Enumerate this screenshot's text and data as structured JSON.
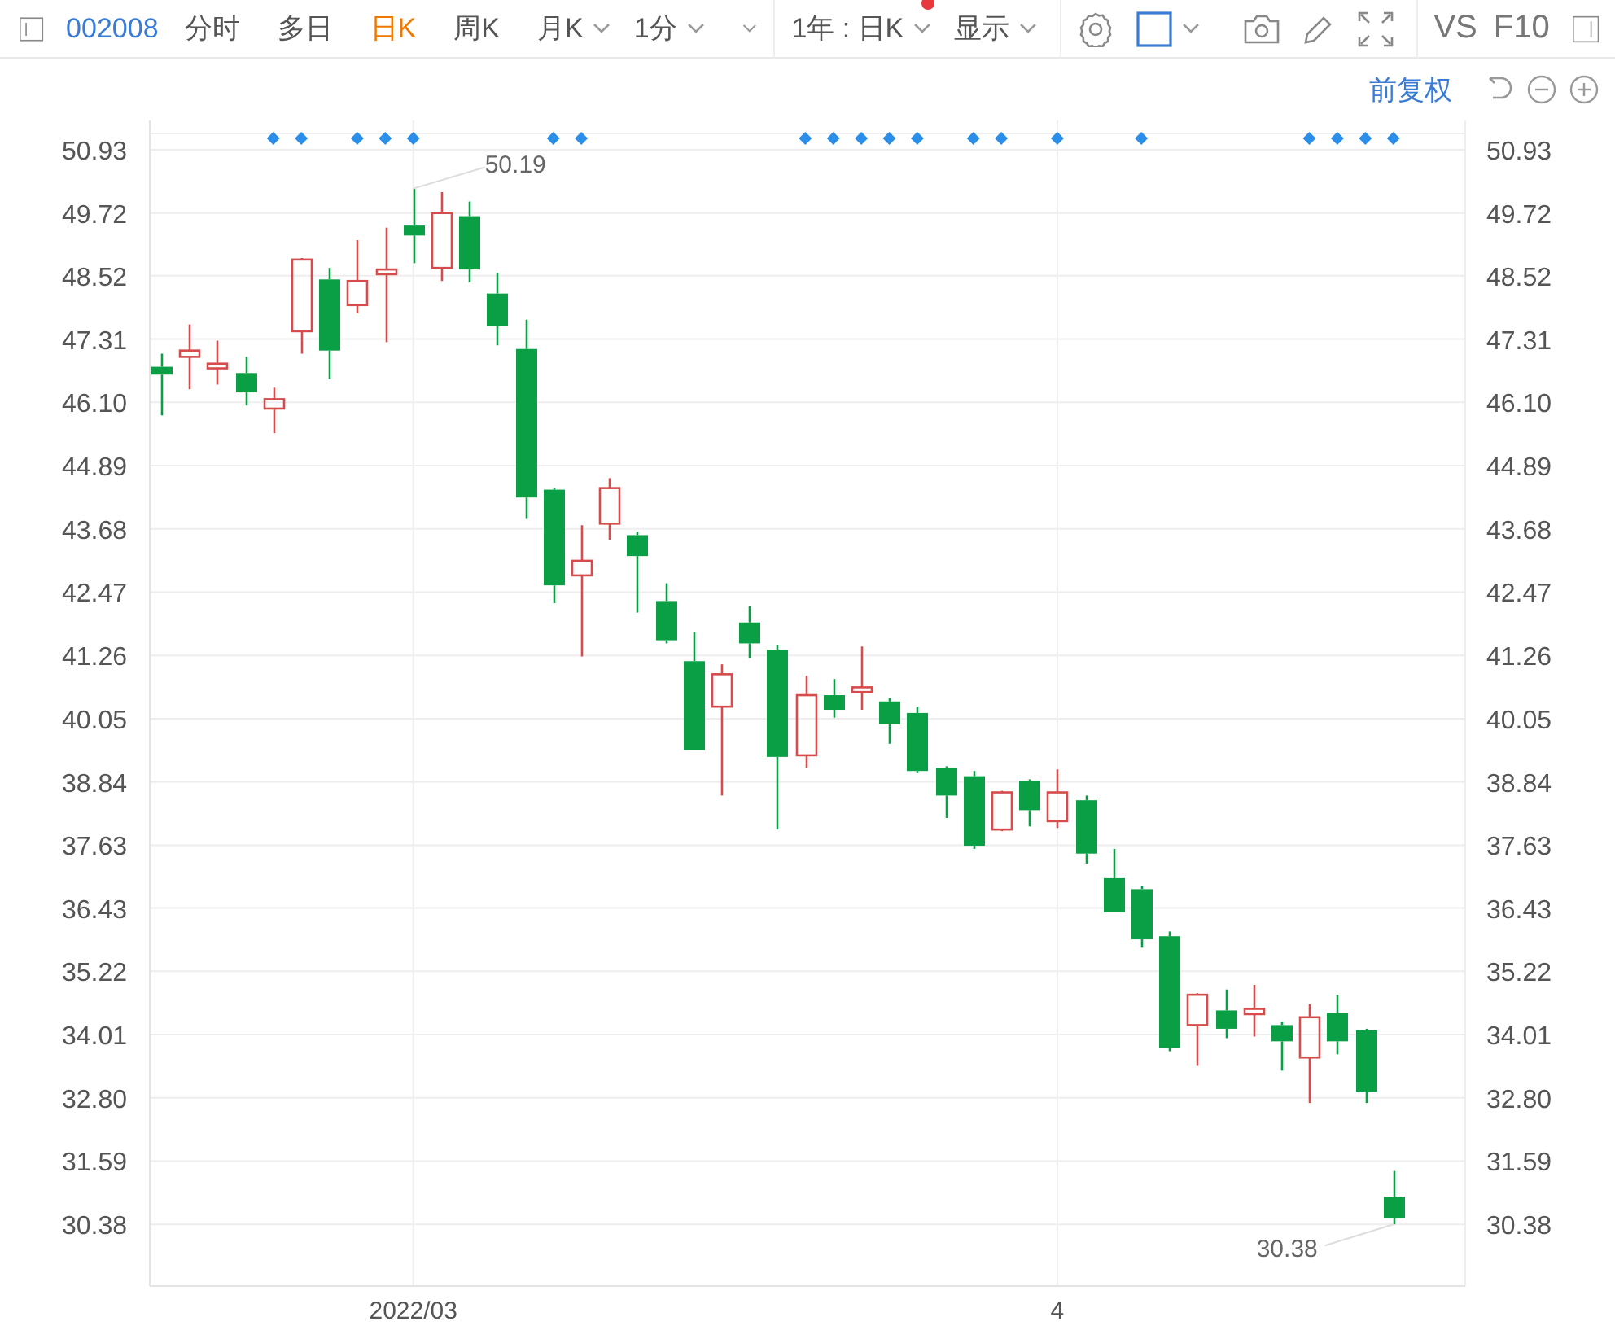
{
  "toolbar": {
    "stock_code": "002008",
    "periods": [
      {
        "label": "分时",
        "kind": "tab",
        "selected": false
      },
      {
        "label": "多日",
        "kind": "tab",
        "selected": false
      },
      {
        "label": "日K",
        "kind": "tab",
        "selected": true
      },
      {
        "label": "周K",
        "kind": "tab",
        "selected": false
      },
      {
        "label": "月K",
        "kind": "dropdown",
        "selected": false
      }
    ],
    "interval": "1分",
    "range": "1年 : 日K",
    "range_notice": true,
    "display": "显示",
    "compare": "VS",
    "f10": "F10"
  },
  "chart_toolbar": {
    "adjustment": "前复权"
  },
  "chart": {
    "event_markers": [
      {
        "shown": false
      },
      {
        "shown": false
      },
      {
        "shown": false
      },
      {
        "shown": false
      },
      {
        "shown": true
      },
      {
        "shown": true
      },
      {
        "shown": false
      },
      {
        "shown": true
      },
      {
        "shown": true
      },
      {
        "shown": true
      },
      {
        "shown": false
      },
      {
        "shown": false
      },
      {
        "shown": false
      },
      {
        "shown": false
      },
      {
        "shown": true
      },
      {
        "shown": true
      },
      {
        "shown": false
      },
      {
        "shown": false
      },
      {
        "shown": false
      },
      {
        "shown": false
      },
      {
        "shown": false
      },
      {
        "shown": false
      },
      {
        "shown": false
      },
      {
        "shown": true
      },
      {
        "shown": true
      },
      {
        "shown": true
      },
      {
        "shown": true
      },
      {
        "shown": true
      },
      {
        "shown": false
      },
      {
        "shown": true
      },
      {
        "shown": true
      },
      {
        "shown": false
      },
      {
        "shown": true
      },
      {
        "shown": false
      },
      {
        "shown": false
      },
      {
        "shown": true
      },
      {
        "shown": false
      },
      {
        "shown": false
      },
      {
        "shown": false
      },
      {
        "shown": false
      },
      {
        "shown": false
      },
      {
        "shown": true
      },
      {
        "shown": true
      },
      {
        "shown": true
      },
      {
        "shown": true
      }
    ],
    "chart_data": {
      "type": "candlestick",
      "grid": true,
      "ylim": [
        29.2,
        51.49
      ],
      "yticks": [
        {
          "value": 50.93,
          "label": "50.93"
        },
        {
          "value": 49.72,
          "label": "49.72"
        },
        {
          "value": 48.52,
          "label": "48.52"
        },
        {
          "value": 47.31,
          "label": "47.31"
        },
        {
          "value": 46.1,
          "label": "46.10"
        },
        {
          "value": 44.89,
          "label": "44.89"
        },
        {
          "value": 43.68,
          "label": "43.68"
        },
        {
          "value": 42.47,
          "label": "42.47"
        },
        {
          "value": 41.26,
          "label": "41.26"
        },
        {
          "value": 40.05,
          "label": "40.05"
        },
        {
          "value": 38.84,
          "label": "38.84"
        },
        {
          "value": 37.63,
          "label": "37.63"
        },
        {
          "value": 36.43,
          "label": "36.43"
        },
        {
          "value": 35.22,
          "label": "35.22"
        },
        {
          "value": 34.01,
          "label": "34.01"
        },
        {
          "value": 32.8,
          "label": "32.80"
        },
        {
          "value": 31.59,
          "label": "31.59"
        },
        {
          "value": 30.38,
          "label": "30.38"
        }
      ],
      "categories": [
        null,
        null,
        null,
        null,
        null,
        null,
        null,
        null,
        null,
        "2022/03",
        null,
        null,
        null,
        null,
        null,
        null,
        null,
        null,
        null,
        null,
        null,
        null,
        null,
        null,
        null,
        null,
        null,
        null,
        null,
        null,
        null,
        null,
        "4",
        null,
        null,
        null,
        null,
        null,
        null,
        null,
        null,
        null,
        null,
        null,
        null
      ],
      "ohlc": [
        [
          46.78,
          47.03,
          45.85,
          46.63
        ],
        [
          46.97,
          47.59,
          46.35,
          47.09
        ],
        [
          46.75,
          47.28,
          46.44,
          46.84
        ],
        [
          46.66,
          46.97,
          46.04,
          46.29
        ],
        [
          45.98,
          46.38,
          45.51,
          46.16
        ],
        [
          47.46,
          48.86,
          47.03,
          48.83
        ],
        [
          48.45,
          48.67,
          46.54,
          47.09
        ],
        [
          47.96,
          49.2,
          47.8,
          48.42
        ],
        [
          48.55,
          49.44,
          47.25,
          48.64
        ],
        [
          49.48,
          50.19,
          48.76,
          49.29
        ],
        [
          48.67,
          50.12,
          48.42,
          49.72
        ],
        [
          49.66,
          49.94,
          48.39,
          48.64
        ],
        [
          48.18,
          48.58,
          47.19,
          47.56
        ],
        [
          47.12,
          47.68,
          43.87,
          44.28
        ],
        [
          44.43,
          44.46,
          42.26,
          42.6
        ],
        [
          42.79,
          43.75,
          41.24,
          43.07
        ],
        [
          43.78,
          44.65,
          43.47,
          44.46
        ],
        [
          43.56,
          43.63,
          42.08,
          43.16
        ],
        [
          42.3,
          42.64,
          41.49,
          41.55
        ],
        [
          41.15,
          41.71,
          39.45,
          39.45
        ],
        [
          40.28,
          41.09,
          38.58,
          40.9
        ],
        [
          41.89,
          42.2,
          41.21,
          41.49
        ],
        [
          41.37,
          41.46,
          37.93,
          39.32
        ],
        [
          39.35,
          40.87,
          39.11,
          40.5
        ],
        [
          40.5,
          40.81,
          40.07,
          40.22
        ],
        [
          40.56,
          41.43,
          40.22,
          40.65
        ],
        [
          40.38,
          40.44,
          39.57,
          39.94
        ],
        [
          40.16,
          40.28,
          39.01,
          39.05
        ],
        [
          39.11,
          39.14,
          38.15,
          38.58
        ],
        [
          38.95,
          39.05,
          37.56,
          37.62
        ],
        [
          37.93,
          38.67,
          37.9,
          38.64
        ],
        [
          38.86,
          38.89,
          37.99,
          38.3
        ],
        [
          38.09,
          39.08,
          37.96,
          38.64
        ],
        [
          38.49,
          38.58,
          37.28,
          37.47
        ],
        [
          37.0,
          37.56,
          36.35,
          36.35
        ],
        [
          36.79,
          36.85,
          35.67,
          35.83
        ],
        [
          35.89,
          35.98,
          33.69,
          33.75
        ],
        [
          34.19,
          34.8,
          33.41,
          34.77
        ],
        [
          34.47,
          34.87,
          33.94,
          34.12
        ],
        [
          34.4,
          34.96,
          33.97,
          34.5
        ],
        [
          34.19,
          34.25,
          33.32,
          33.88
        ],
        [
          33.57,
          34.59,
          32.7,
          34.34
        ],
        [
          34.43,
          34.77,
          33.63,
          33.88
        ],
        [
          34.09,
          34.12,
          32.7,
          32.92
        ],
        [
          30.91,
          31.4,
          30.38,
          30.5
        ]
      ],
      "annotations": [
        "50.19",
        "30.38"
      ]
    }
  }
}
